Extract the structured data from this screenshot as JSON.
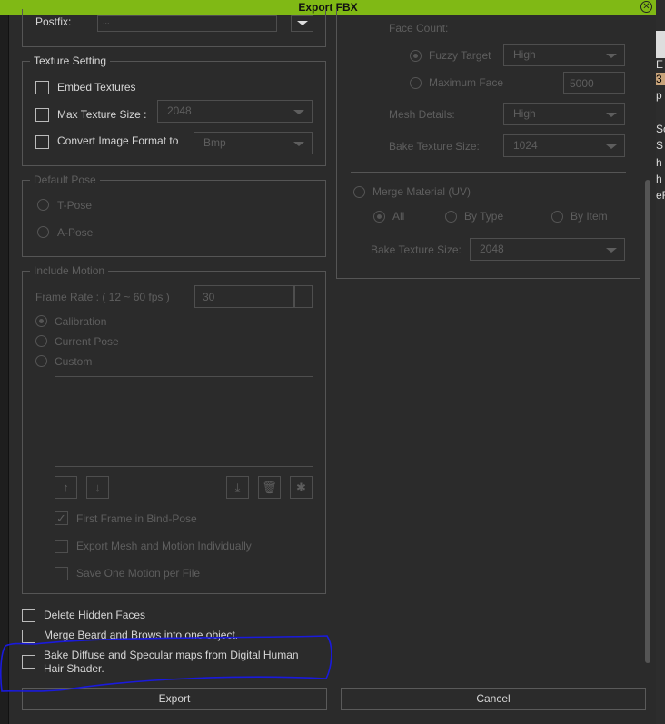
{
  "window": {
    "title": "Export FBX"
  },
  "naming": {
    "postfix_label": "Postfix:",
    "postfix_value": "..."
  },
  "texture": {
    "legend": "Texture Setting",
    "embed": "Embed Textures",
    "max_size": "Max Texture Size :",
    "max_size_value": "2048",
    "convert": "Convert Image Format to",
    "convert_value": "Bmp"
  },
  "pose": {
    "legend": "Default Pose",
    "t": "T-Pose",
    "a": "A-Pose"
  },
  "motion": {
    "legend": "Include Motion",
    "frame_rate": "Frame Rate : ( 12 ~ 60 fps )",
    "frame_rate_value": "30",
    "calibration": "Calibration",
    "current": "Current Pose",
    "custom": "Custom",
    "first_frame": "First Frame in Bind-Pose",
    "export_individually": "Export Mesh and Motion Individually",
    "save_one": "Save One Motion per File"
  },
  "options": {
    "delete_hidden": "Delete Hidden Faces",
    "merge_beard": "Merge Beard and Brows into one object.",
    "bake_diffuse": "Bake Diffuse and Specular maps from Digital Human Hair Shader."
  },
  "reduce": {
    "face_count": "Face Count:",
    "fuzzy": "Fuzzy Target",
    "fuzzy_value": "High",
    "max_face": "Maximum Face",
    "max_face_value": "5000",
    "mesh_details": "Mesh Details:",
    "mesh_details_value": "High",
    "bake_size": "Bake Texture Size:",
    "bake_size_value": "1024"
  },
  "merge": {
    "label": "Merge Material (UV)",
    "all": "All",
    "by_type": "By Type",
    "by_item": "By Item",
    "bake_size": "Bake Texture Size:",
    "bake_size_value": "2048"
  },
  "buttons": {
    "export": "Export",
    "cancel": "Cancel"
  },
  "background_text": [
    "E",
    "3",
    "p",
    "So",
    "S",
    "h",
    "h",
    "eR"
  ],
  "colors": {
    "titlebar": "#80b915",
    "annotation": "#1a1adc"
  }
}
